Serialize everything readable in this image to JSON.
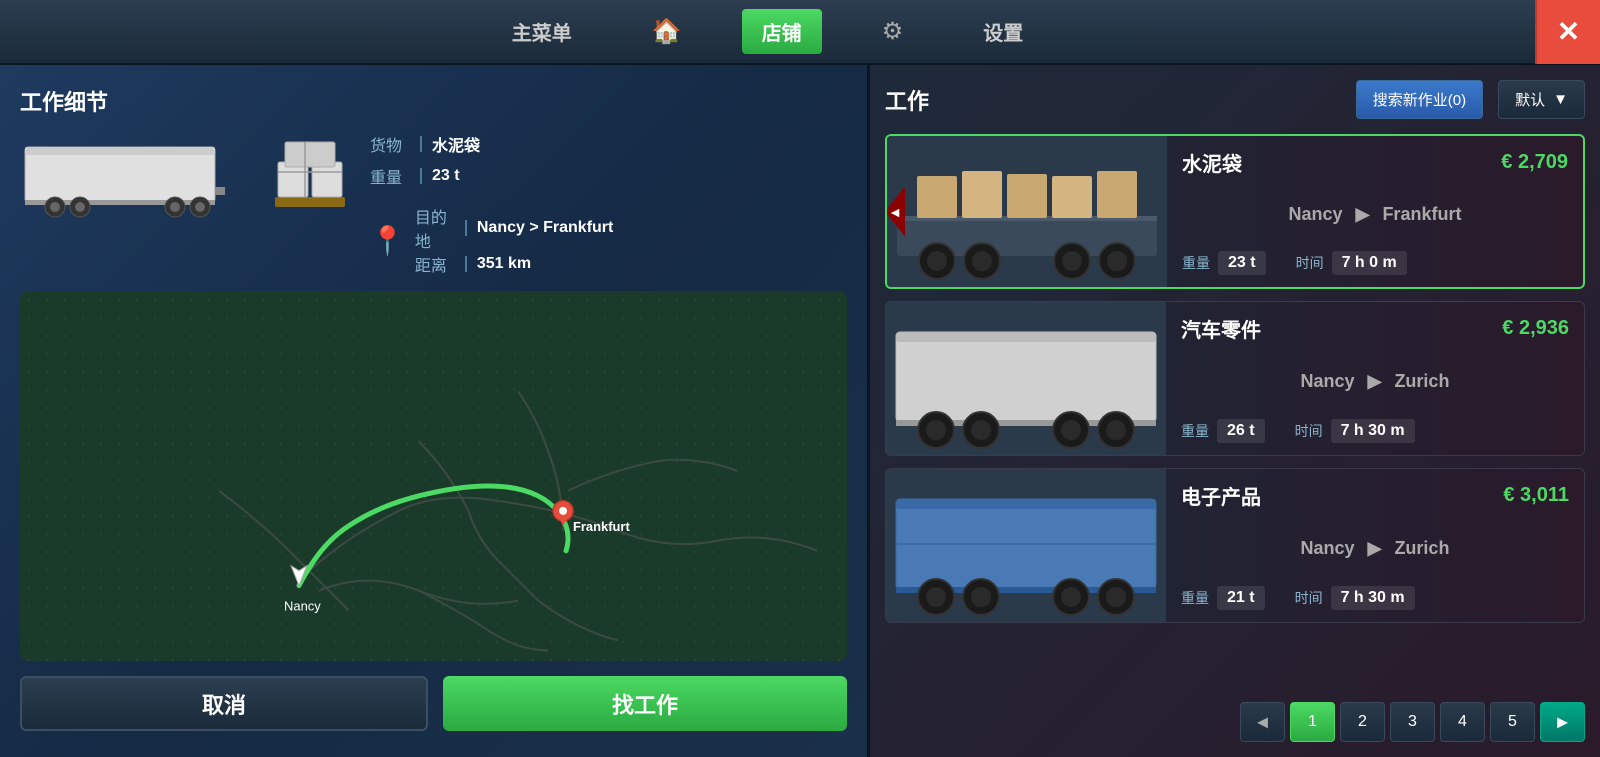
{
  "nav": {
    "main_menu": "主菜单",
    "home_icon": "🏠",
    "shop": "店铺",
    "settings_icon": "⚙",
    "settings": "设置",
    "close": "✕"
  },
  "left_panel": {
    "title": "工作细节",
    "cargo_label": "货物",
    "cargo_value": "水泥袋",
    "weight_label": "重量",
    "weight_value": "23 t",
    "destination_label": "目的地",
    "destination_value": "Nancy > Frankfurt",
    "distance_label": "距离",
    "distance_value": "351 km",
    "cancel_btn": "取消",
    "find_btn": "找工作",
    "frankfurt_label": "Frankfurt",
    "nancy_label": "Nancy"
  },
  "right_panel": {
    "title": "工作",
    "search_btn": "搜索新作业(0)",
    "sort_btn": "默认",
    "left_arrow": "◄",
    "jobs": [
      {
        "cargo": "水泥袋",
        "price": "€ 2,709",
        "from": "Nancy",
        "to": "Frankfurt",
        "weight": "23 t",
        "time": "7 h 0 m",
        "weight_label": "重量",
        "time_label": "时间",
        "trailer_type": "flat"
      },
      {
        "cargo": "汽车零件",
        "price": "€ 2,936",
        "from": "Nancy",
        "to": "Zurich",
        "weight": "26 t",
        "time": "7 h 30 m",
        "weight_label": "重量",
        "time_label": "时间",
        "trailer_type": "box-white"
      },
      {
        "cargo": "电子产品",
        "price": "€ 3,011",
        "from": "Nancy",
        "to": "Zurich",
        "weight": "21 t",
        "time": "7 h 30 m",
        "weight_label": "重量",
        "time_label": "时间",
        "trailer_type": "box-blue"
      }
    ],
    "pagination": {
      "prev_arrow": "◄",
      "pages": [
        "1",
        "2",
        "3",
        "4",
        "5"
      ],
      "next_arrow": "►"
    }
  }
}
